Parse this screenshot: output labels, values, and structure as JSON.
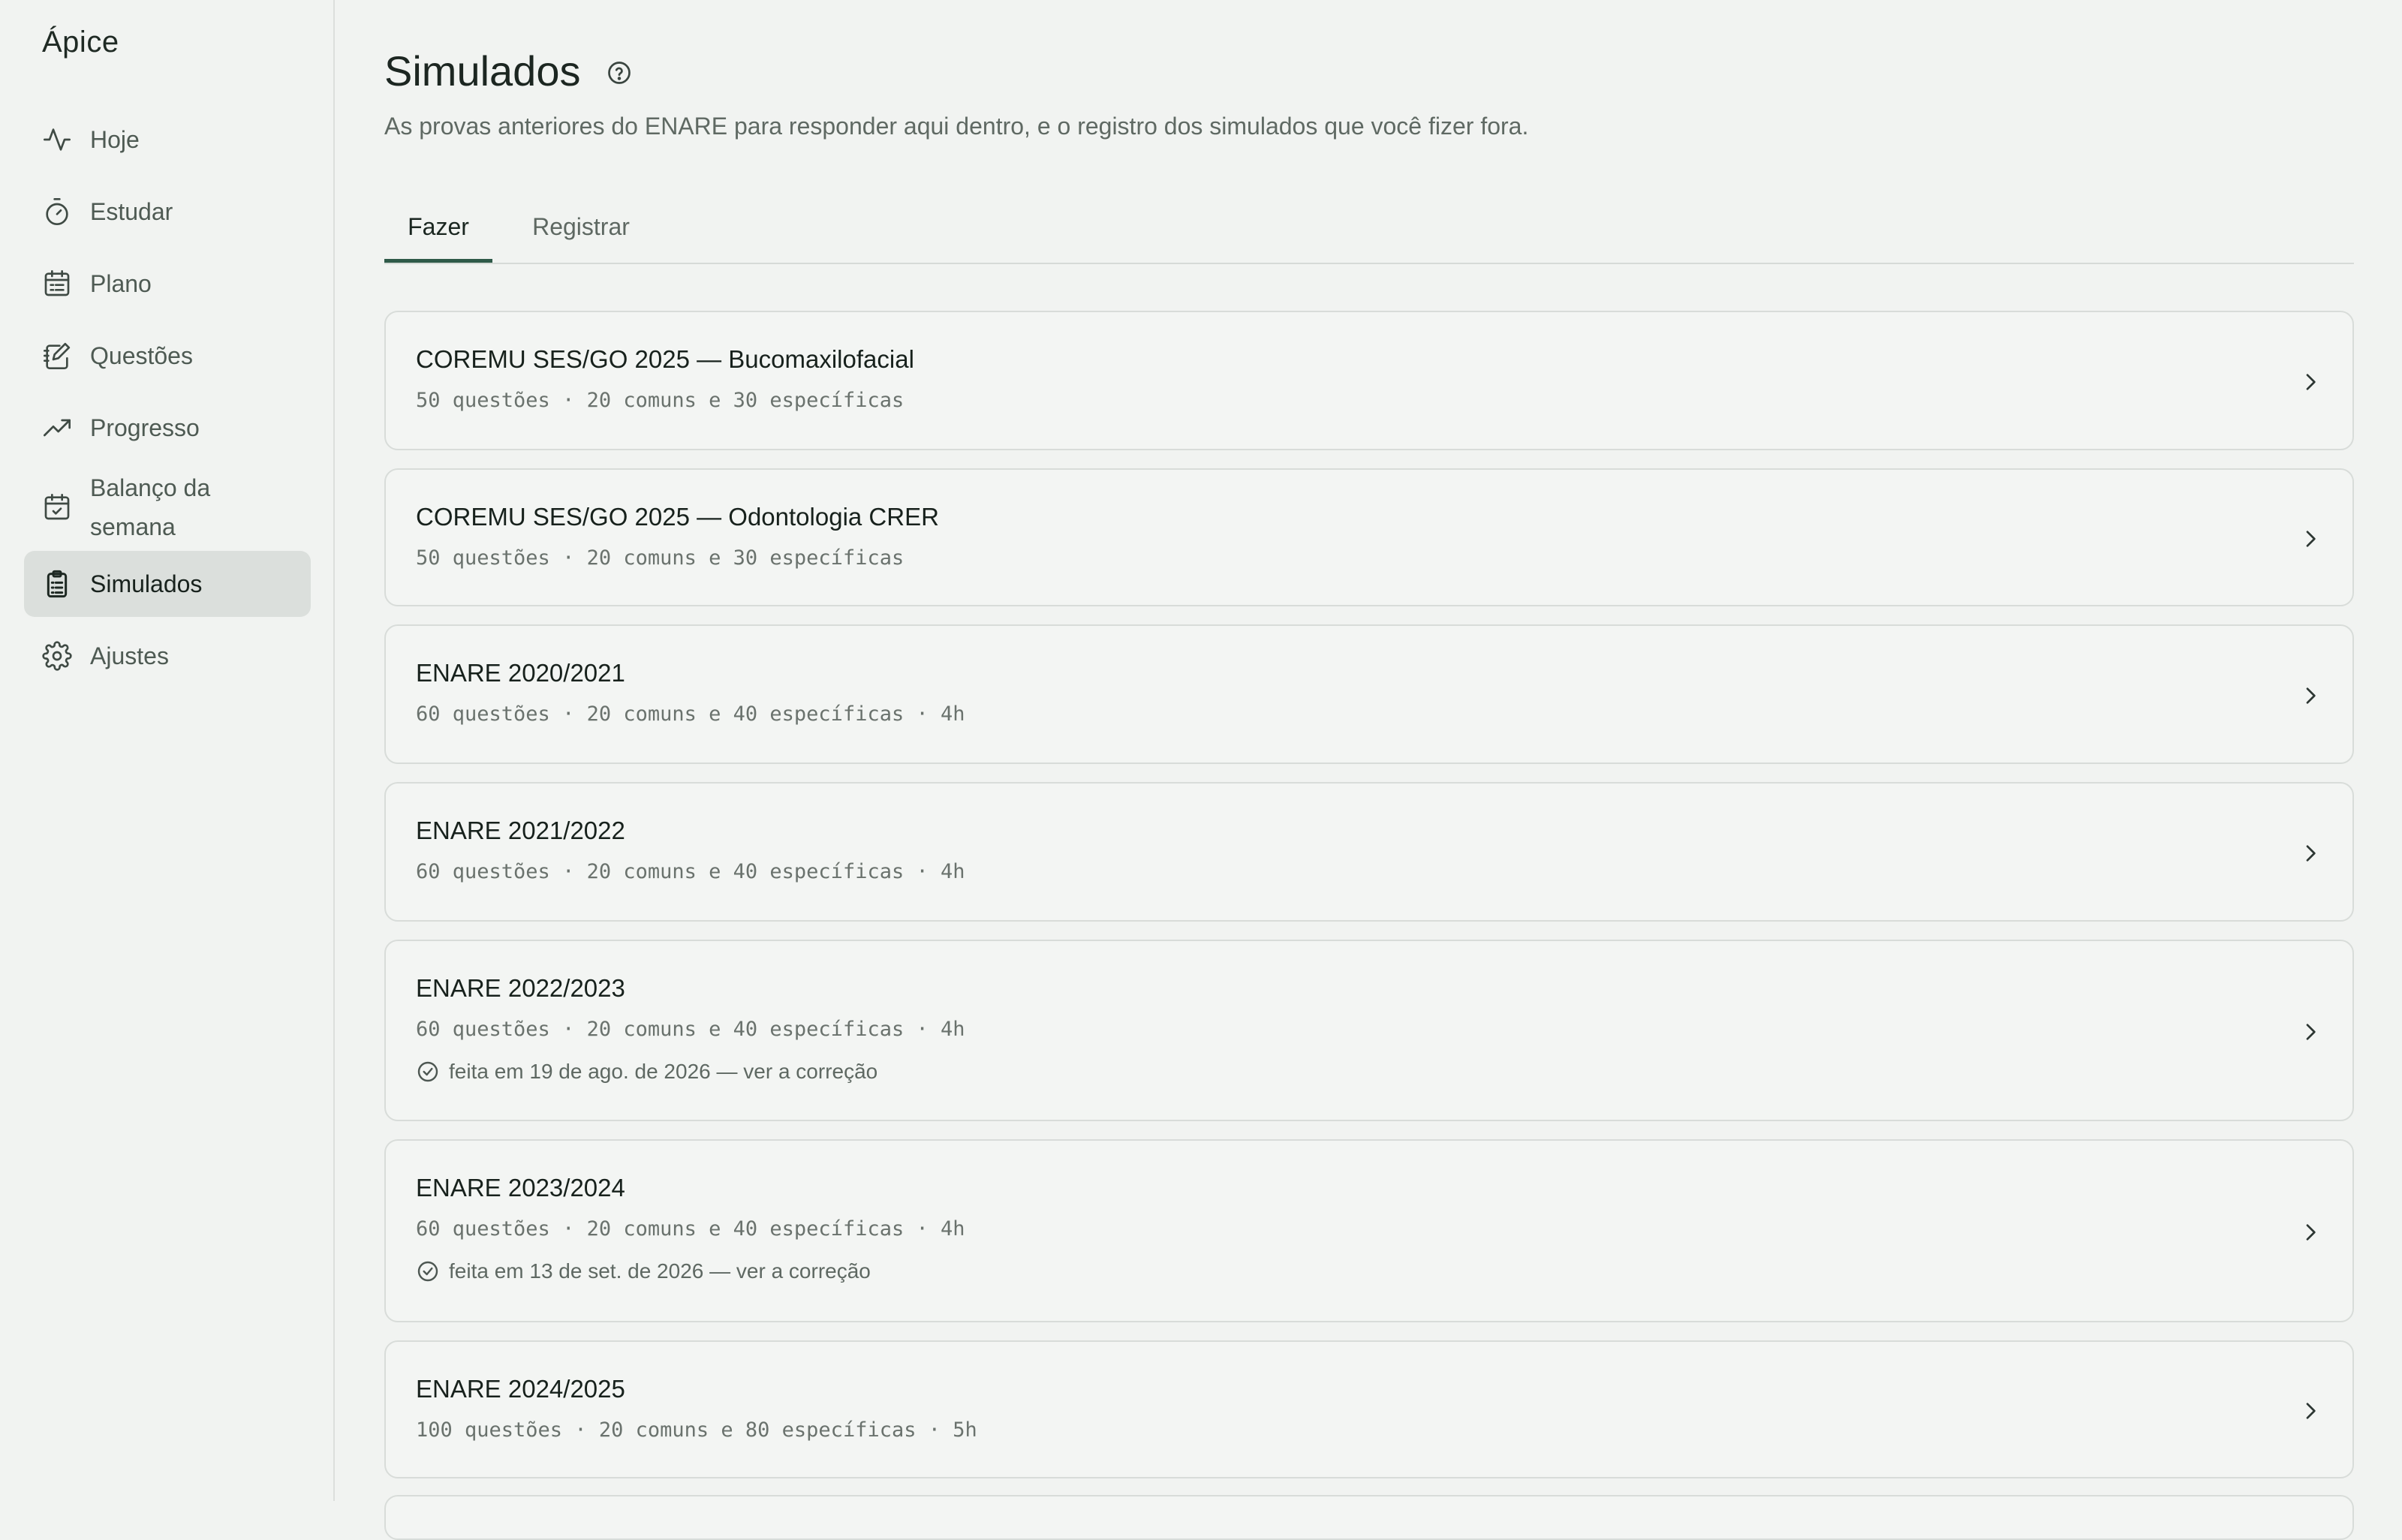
{
  "app": {
    "name": "Ápice"
  },
  "sidebar": {
    "items": [
      {
        "label": "Hoje",
        "icon": "activity-icon",
        "active": false
      },
      {
        "label": "Estudar",
        "icon": "timer-icon",
        "active": false
      },
      {
        "label": "Plano",
        "icon": "calendar-list-icon",
        "active": false
      },
      {
        "label": "Questões",
        "icon": "edit-notes-icon",
        "active": false
      },
      {
        "label": "Progresso",
        "icon": "trending-up-icon",
        "active": false
      },
      {
        "label": "Balanço da semana",
        "icon": "calendar-check-icon",
        "active": false
      },
      {
        "label": "Simulados",
        "icon": "clipboard-list-icon",
        "active": true
      },
      {
        "label": "Ajustes",
        "icon": "gear-icon",
        "active": false
      }
    ]
  },
  "page": {
    "title": "Simulados",
    "subtitle": "As provas anteriores do ENARE para responder aqui dentro, e o registro dos simulados que você fizer fora.",
    "tabs": [
      {
        "label": "Fazer",
        "active": true
      },
      {
        "label": "Registrar",
        "active": false
      }
    ]
  },
  "exams": [
    {
      "title": "COREMU SES/GO 2025 — Bucomaxilofacial",
      "meta": "50 questões · 20 comuns e 30 específicas"
    },
    {
      "title": "COREMU SES/GO 2025 — Odontologia CRER",
      "meta": "50 questões · 20 comuns e 30 específicas"
    },
    {
      "title": "ENARE 2020/2021",
      "meta": "60 questões · 20 comuns e 40 específicas · 4h"
    },
    {
      "title": "ENARE 2021/2022",
      "meta": "60 questões · 20 comuns e 40 específicas · 4h"
    },
    {
      "title": "ENARE 2022/2023",
      "meta": "60 questões · 20 comuns e 40 específicas · 4h",
      "done": "feita em 19 de ago. de 2026 — ver a correção"
    },
    {
      "title": "ENARE 2023/2024",
      "meta": "60 questões · 20 comuns e 40 específicas · 4h",
      "done": "feita em 13 de set. de 2026 — ver a correção"
    },
    {
      "title": "ENARE 2024/2025",
      "meta": "100 questões · 20 comuns e 80 específicas · 5h"
    }
  ]
}
